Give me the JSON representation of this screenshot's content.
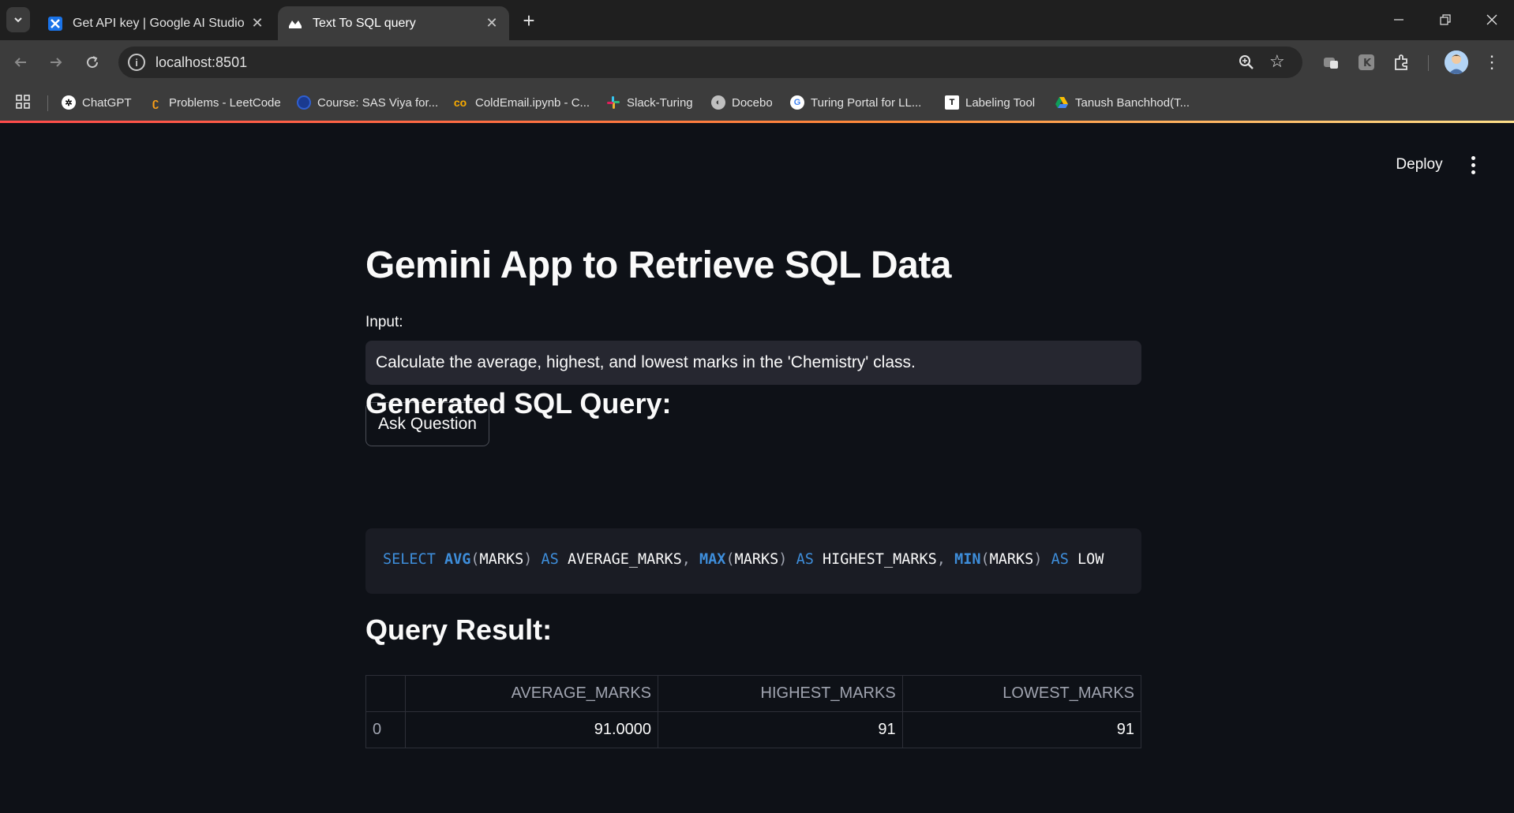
{
  "browser": {
    "tabs": [
      {
        "title": "Get API key | Google AI Studio",
        "active": false,
        "icon": "google-ai-studio-icon"
      },
      {
        "title": "Text To SQL query",
        "active": true,
        "icon": "streamlit-icon"
      }
    ],
    "url": "localhost:8501",
    "bookmarks": [
      {
        "label": "ChatGPT",
        "icon": "chatgpt-icon"
      },
      {
        "label": "Problems - LeetCode",
        "icon": "leetcode-icon"
      },
      {
        "label": "Course: SAS Viya for...",
        "icon": "sas-icon"
      },
      {
        "label": "ColdEmail.ipynb - C...",
        "icon": "colab-icon"
      },
      {
        "label": "Slack-Turing",
        "icon": "slack-icon"
      },
      {
        "label": "Docebo",
        "icon": "docebo-icon"
      },
      {
        "label": "Turing Portal for LL...",
        "icon": "google-icon"
      },
      {
        "label": "Labeling Tool",
        "icon": "labeling-tool-icon"
      },
      {
        "label": "Tanush Banchhod(T...",
        "icon": "google-drive-icon"
      }
    ]
  },
  "app": {
    "deploy_label": "Deploy",
    "title": "Gemini App to Retrieve SQL Data",
    "input": {
      "label": "Input:",
      "value": "Calculate the average, highest, and lowest marks in the 'Chemistry' class."
    },
    "ask_button": "Ask Question",
    "sql_heading": "Generated SQL Query:",
    "sql_query": "SELECT AVG(MARKS) AS AVERAGE_MARKS, MAX(MARKS) AS HIGHEST_MARKS, MIN(MARKS) AS LOW",
    "result_heading": "Query Result:",
    "table": {
      "columns": [
        "",
        "AVERAGE_MARKS",
        "HIGHEST_MARKS",
        "LOWEST_MARKS"
      ],
      "rows": [
        [
          "0",
          "91.0000",
          "91",
          "91"
        ]
      ]
    }
  },
  "colors": {
    "app_background": "#0e1117",
    "input_background": "#262730",
    "code_background": "#1a1c24",
    "sql_keyword": "#3e8edb",
    "accent_gradient_start": "#ff4b4b"
  }
}
